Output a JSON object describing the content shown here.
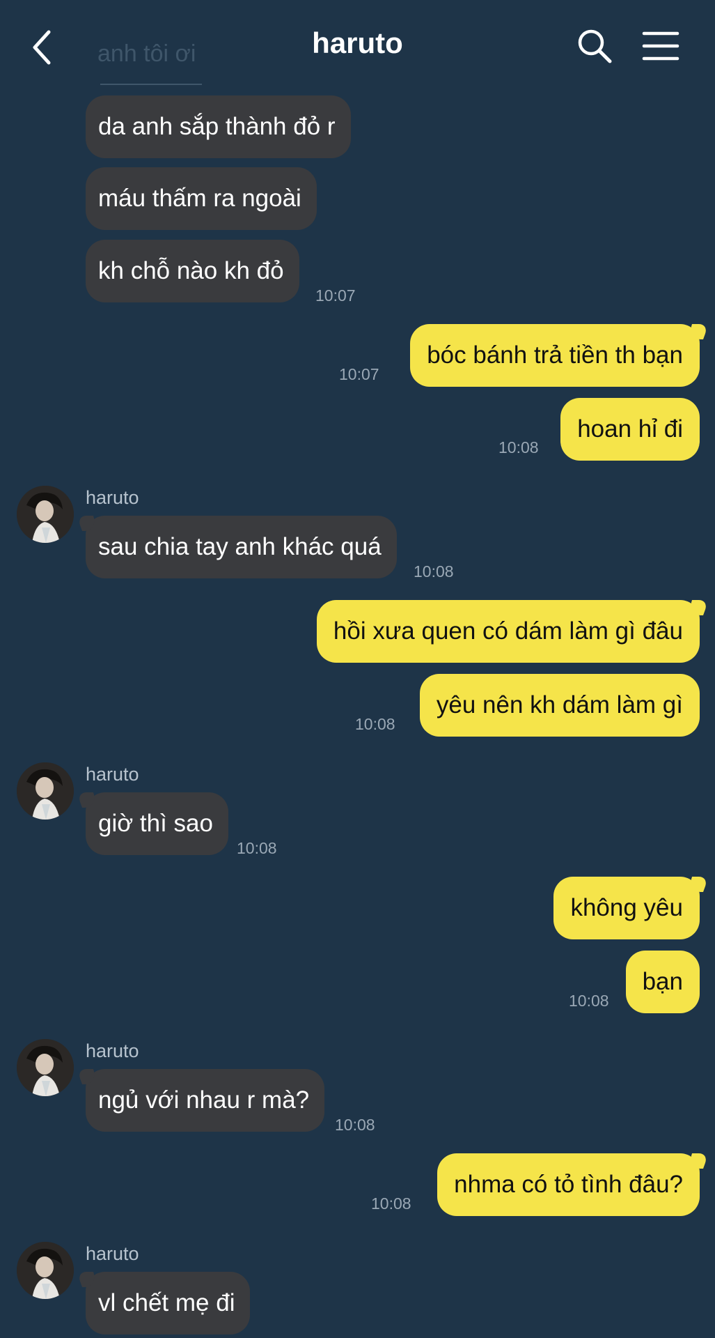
{
  "header": {
    "title": "haruto",
    "faded_preview": "anh tôi ơi"
  },
  "icons": {
    "back": "chevron-left-icon",
    "search": "search-icon",
    "menu": "hamburger-menu-icon"
  },
  "colors": {
    "background": "#1e3448",
    "incoming_bubble": "#3a3b3e",
    "outgoing_bubble": "#f5e44a",
    "timestamp": "#9aa8b5"
  },
  "messages": [
    {
      "dir": "in",
      "text": "da anh sắp thành đỏ r"
    },
    {
      "dir": "in",
      "text": "máu thấm ra ngoài"
    },
    {
      "dir": "in",
      "text": "kh chỗ nào kh đỏ",
      "time": "10:07"
    },
    {
      "dir": "out",
      "text": "bóc bánh trả tiền th bạn",
      "time": "10:07"
    },
    {
      "dir": "out",
      "text": "hoan hỉ đi",
      "time": "10:08"
    },
    {
      "dir": "in",
      "sender": "haruto",
      "text": "sau chia tay anh khác quá",
      "time": "10:08"
    },
    {
      "dir": "out",
      "text": "hồi xưa quen có dám làm gì đâu"
    },
    {
      "dir": "out",
      "text": "yêu nên kh dám làm gì",
      "time": "10:08"
    },
    {
      "dir": "in",
      "sender": "haruto",
      "text": "giờ thì sao",
      "time": "10:08"
    },
    {
      "dir": "out",
      "text": "không yêu"
    },
    {
      "dir": "out",
      "text": "bạn",
      "time": "10:08"
    },
    {
      "dir": "in",
      "sender": "haruto",
      "text": "ngủ với nhau r mà?",
      "time": "10:08"
    },
    {
      "dir": "out",
      "text": "nhma có tỏ tình đâu?",
      "time": "10:08"
    },
    {
      "dir": "in",
      "sender": "haruto",
      "text": "vl chết mẹ đi"
    }
  ]
}
